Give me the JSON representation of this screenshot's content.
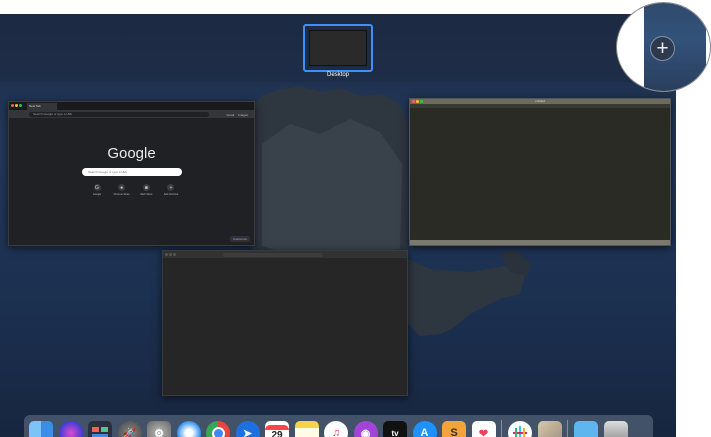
{
  "spaces": {
    "desktop_label": "Desktop",
    "add_space": "+"
  },
  "chrome": {
    "tab_title": "New Tab",
    "omnibox_placeholder": "Search Google or type a URL",
    "links": [
      "Gmail",
      "Images"
    ],
    "logo": "Google",
    "search_placeholder": "Search Google or type a URL",
    "shortcuts": [
      "Google",
      "Chrome Store",
      "Web Store",
      "Add shortcut"
    ],
    "customize": "Customize"
  },
  "editor": {
    "title": "untitled"
  },
  "dock": {
    "calendar_day": "29",
    "apptv_label": "tv",
    "colors": {
      "finder": "#4aa0f0",
      "siri": "#7b45d8",
      "chrome_red": "#e8453c"
    },
    "items": [
      "Finder",
      "Siri",
      "Mission Control",
      "Launchpad",
      "System Preferences",
      "Safari",
      "Google Chrome",
      "Maps",
      "Calendar",
      "Notes",
      "Music",
      "Podcasts",
      "Apple TV",
      "App Store",
      "Sublime Text",
      "Pocket",
      "Slack",
      "Preview",
      "Downloads",
      "Trash"
    ]
  }
}
